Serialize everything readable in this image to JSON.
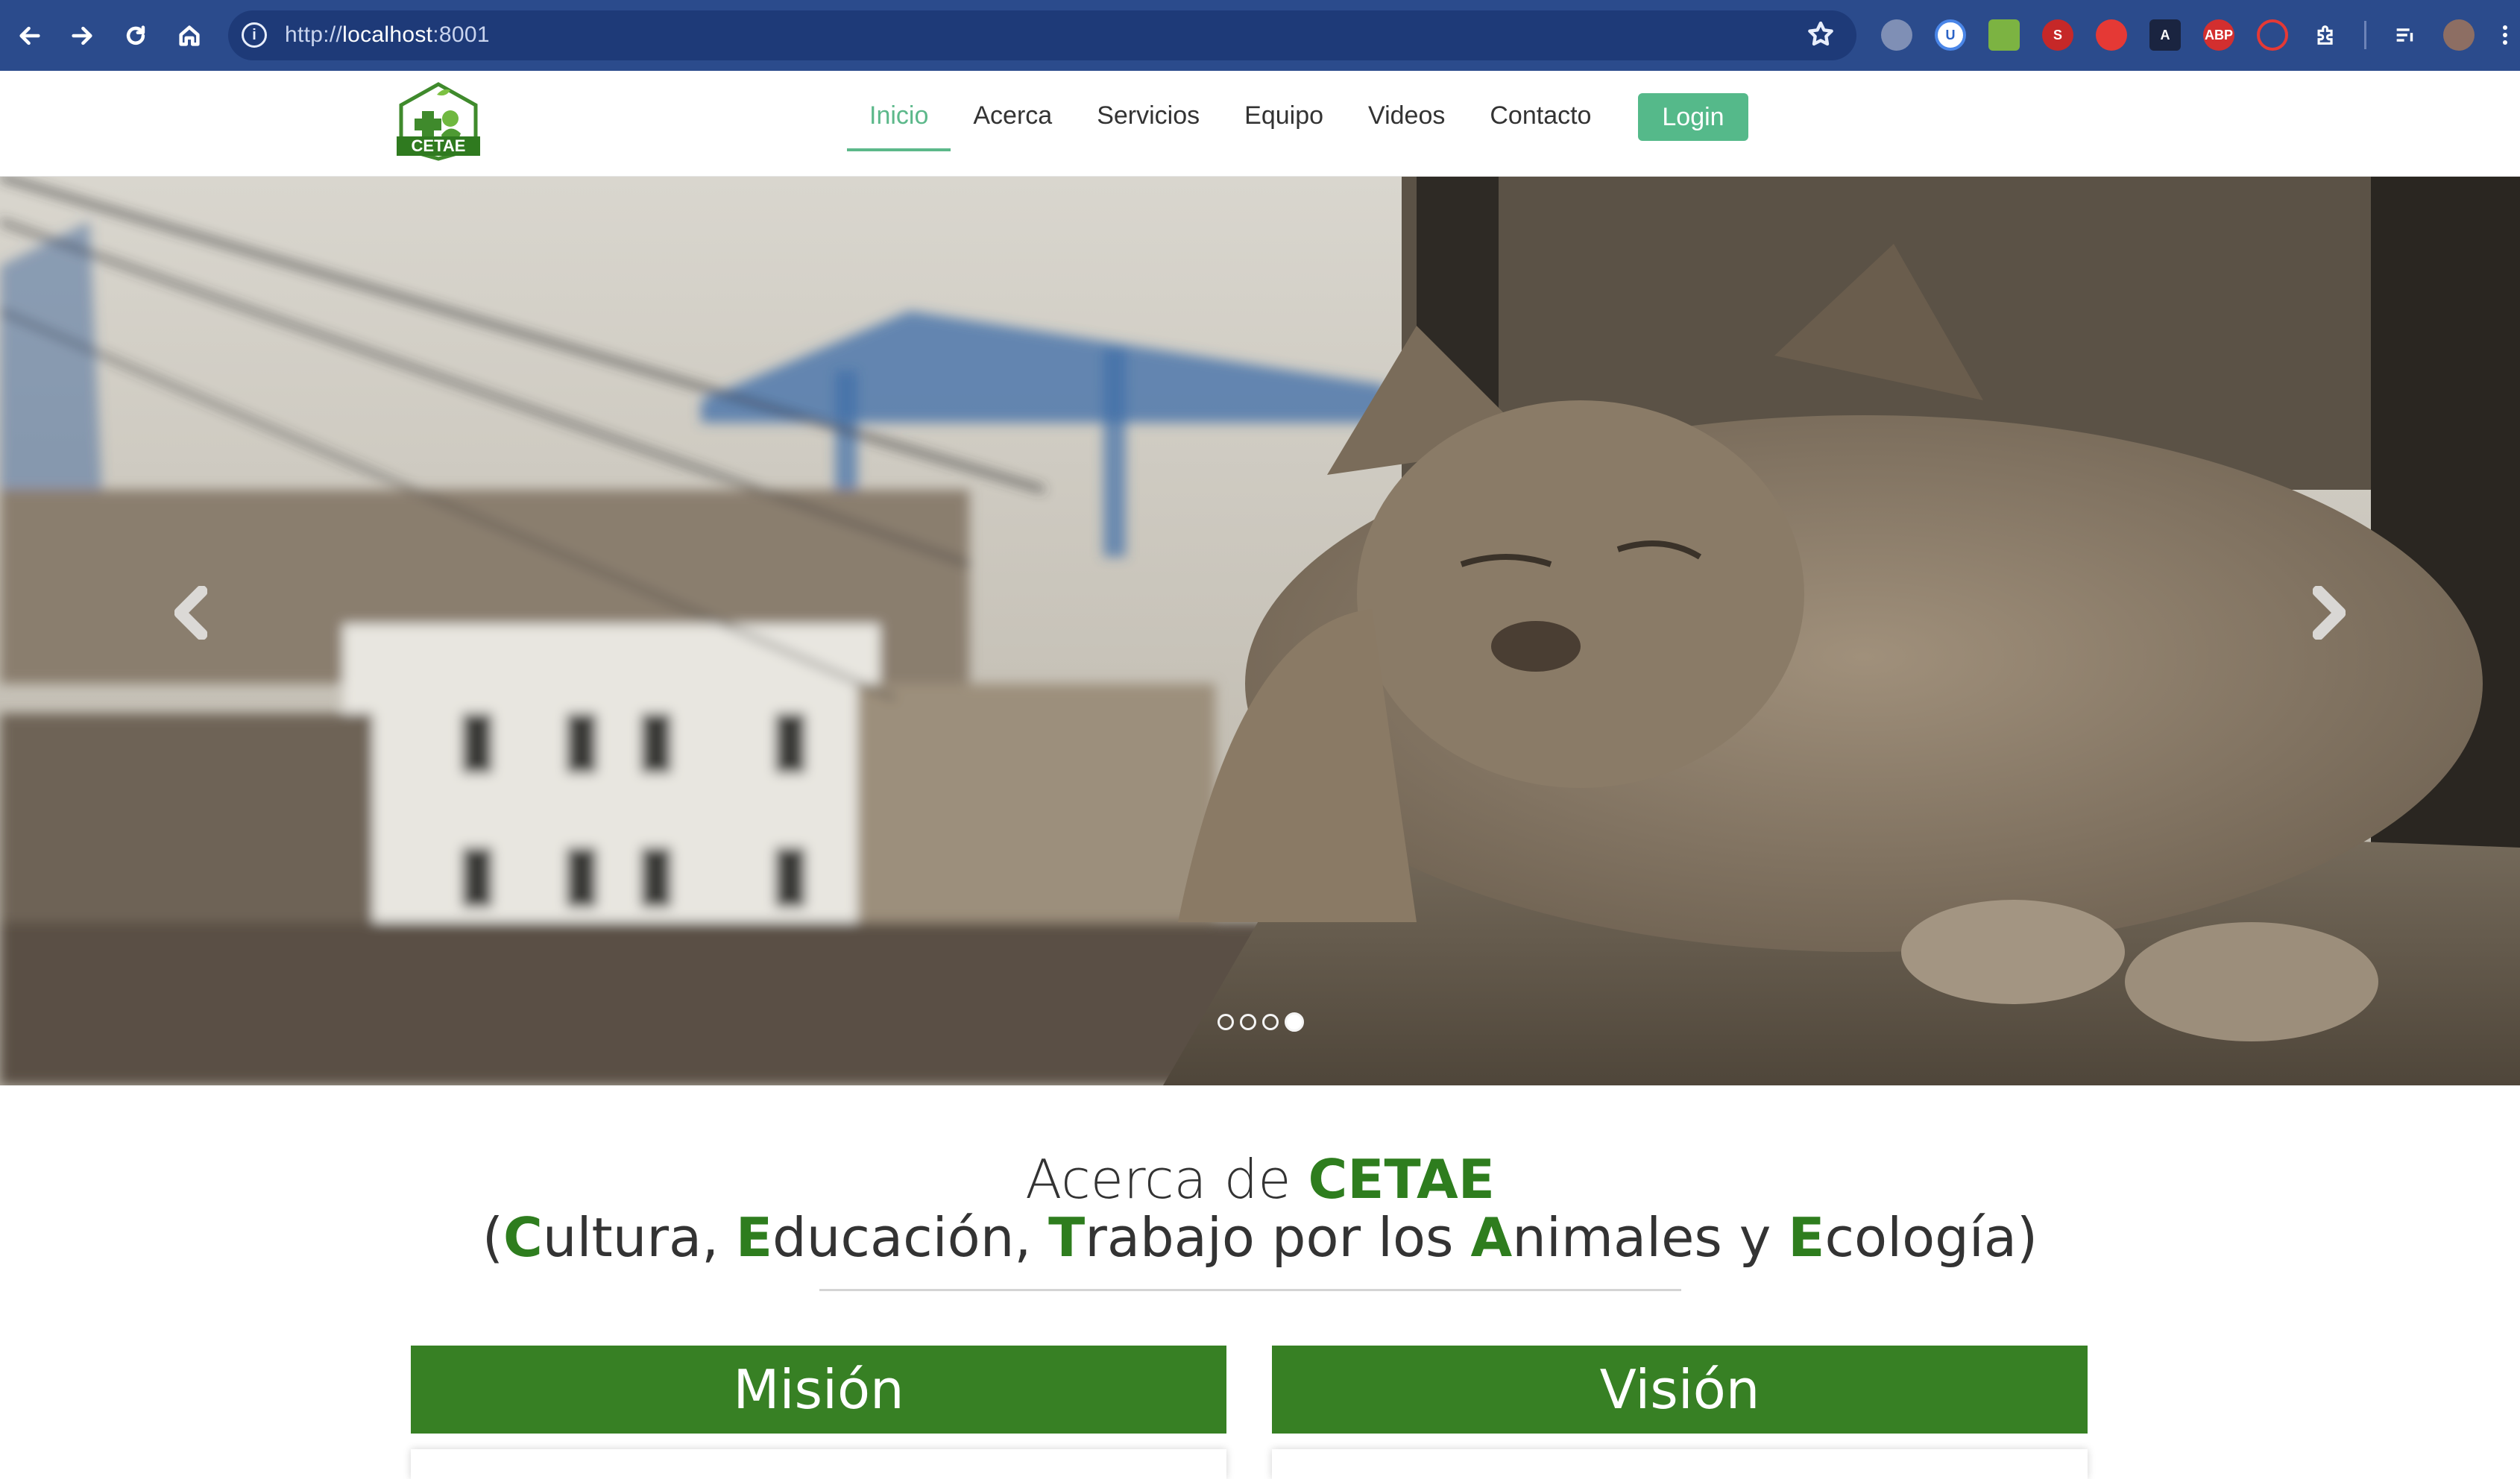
{
  "browser": {
    "url_scheme": "http://",
    "url_host": "localhost",
    "url_port": ":8001",
    "toolbar_color": "#2b4b8c"
  },
  "site": {
    "logo_text": "CETAE",
    "nav": [
      "Inicio",
      "Acerca",
      "Servicios",
      "Equipo",
      "Videos",
      "Contacto"
    ],
    "active_nav": "Inicio",
    "login_label": "Login",
    "accent": "#5cb88a"
  },
  "carousel": {
    "slide_count": 4,
    "active_slide": 4,
    "prev_icon": "chevron-left-icon",
    "next_icon": "chevron-right-icon"
  },
  "about": {
    "title_prefix": "Acerca de ",
    "title_brand": "CETAE",
    "sub_parts": [
      {
        "text": "(",
        "green": false
      },
      {
        "text": "C",
        "green": true
      },
      {
        "text": "ultura, ",
        "green": false
      },
      {
        "text": "E",
        "green": true
      },
      {
        "text": "ducación, ",
        "green": false
      },
      {
        "text": "T",
        "green": true
      },
      {
        "text": "rabajo por los ",
        "green": false
      },
      {
        "text": "A",
        "green": true
      },
      {
        "text": "nimales y ",
        "green": false
      },
      {
        "text": "E",
        "green": true
      },
      {
        "text": "cología)",
        "green": false
      }
    ],
    "mision_label": "Misión",
    "vision_label": "Visión",
    "brand_green": "#378024"
  }
}
